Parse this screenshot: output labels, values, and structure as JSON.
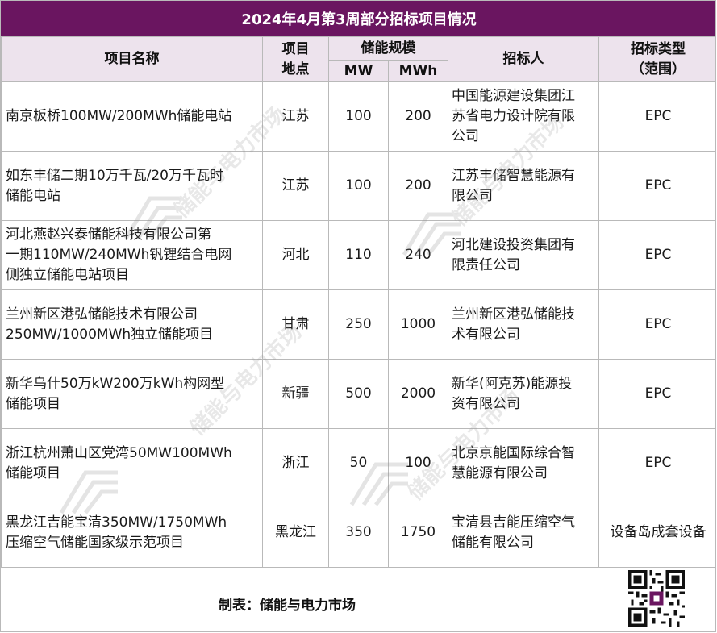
{
  "title": "2024年4月第3周部分招标项目情况",
  "headers": {
    "project_name": "项目名称",
    "location_line1": "项目",
    "location_line2": "地点",
    "scale": "储能规模",
    "mw": "MW",
    "mwh": "MWh",
    "bidder": "招标人",
    "type_line1": "招标类型",
    "type_line2": "（范围）"
  },
  "rows": [
    {
      "name_lines": [
        "南京板桥100MW/200MWh储能电站"
      ],
      "location": "江苏",
      "mw": "100",
      "mwh": "200",
      "bidder_lines": [
        "中国能源建设集团江",
        "苏省电力设计院有限",
        "公司"
      ],
      "type": "EPC"
    },
    {
      "name_lines": [
        "如东丰储二期10万千瓦/20万千瓦时",
        "储能电站"
      ],
      "location": "江苏",
      "mw": "100",
      "mwh": "200",
      "bidder_lines": [
        "江苏丰储智慧能源有",
        "限公司"
      ],
      "type": "EPC"
    },
    {
      "name_lines": [
        "河北燕赵兴泰储能科技有限公司第",
        "一期110MW/240MWh钒锂结合电网",
        "侧独立储能电站项目"
      ],
      "location": "河北",
      "mw": "110",
      "mwh": "240",
      "bidder_lines": [
        "河北建设投资集团有",
        "限责任公司"
      ],
      "type": "EPC"
    },
    {
      "name_lines": [
        "兰州新区港弘储能技术有限公司",
        "250MW/1000MWh独立储能项目"
      ],
      "location": "甘肃",
      "mw": "250",
      "mwh": "1000",
      "bidder_lines": [
        "兰州新区港弘储能技",
        "术有限公司"
      ],
      "type": "EPC"
    },
    {
      "name_lines": [
        "新华乌什50万kW200万kWh构网型",
        "储能项目"
      ],
      "location": "新疆",
      "mw": "500",
      "mwh": "2000",
      "bidder_lines": [
        "新华(阿克苏)能源投",
        "资有限公司"
      ],
      "type": "EPC"
    },
    {
      "name_lines": [
        "浙江杭州萧山区党湾50MW100MWh",
        "储能项目"
      ],
      "location": "浙江",
      "mw": "50",
      "mwh": "100",
      "bidder_lines": [
        "北京京能国际综合智",
        "慧能源有限公司"
      ],
      "type": "EPC"
    },
    {
      "name_lines": [
        "黑龙江吉能宝清350MW/1750MWh",
        "压缩空气储能国家级示范项目"
      ],
      "location": "黑龙江",
      "mw": "350",
      "mwh": "1750",
      "bidder_lines": [
        "宝清县吉能压缩空气",
        "储能有限公司"
      ],
      "type": "设备岛成套设备"
    }
  ],
  "footer": "制表：储能与电力市场",
  "watermark_text": "储能与电力市场",
  "icons": {
    "qr": "qr-code-icon",
    "watermark_logo": "watermark-logo-icon"
  },
  "colors": {
    "title_bg": "#6a1560",
    "header_bg": "#ede3ed",
    "border": "#b9b9b9"
  }
}
